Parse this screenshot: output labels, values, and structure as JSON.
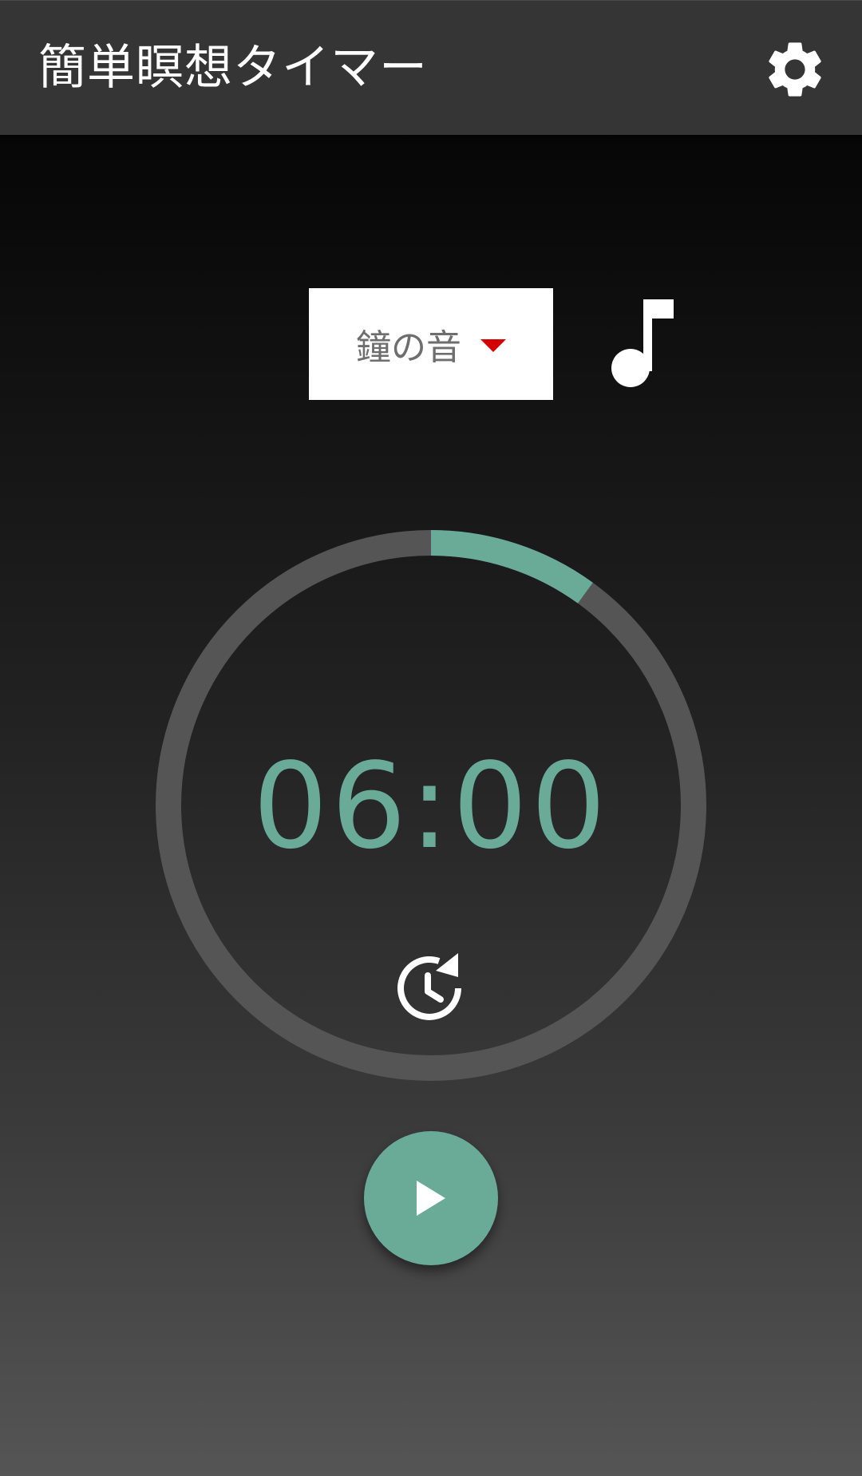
{
  "app": {
    "title": "簡単瞑想タイマー"
  },
  "sound": {
    "selected": "鐘の音"
  },
  "timer": {
    "display": "06:00",
    "progress_fraction": 0.1
  },
  "icons": {
    "settings": "gear-icon",
    "music": "music-note-icon",
    "reset": "restore-clock-icon",
    "play": "play-icon"
  },
  "colors": {
    "accent": "#6aab98",
    "appbar": "#353535",
    "track": "#555555",
    "dropdown_arrow": "#d40000"
  }
}
